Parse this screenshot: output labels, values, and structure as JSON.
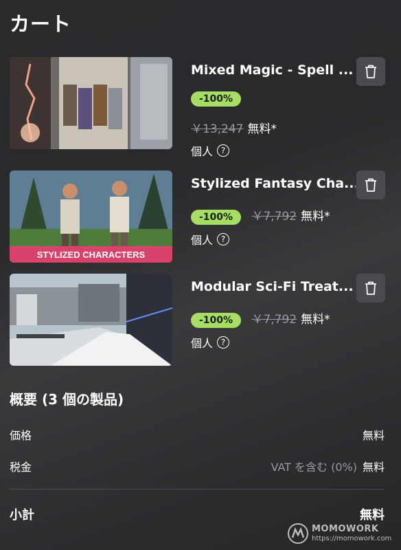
{
  "page": {
    "title": "カート"
  },
  "colors": {
    "badge_green": "#a6dd62",
    "delete_bg": "#4b4b4f",
    "muted": "#9a9a9e"
  },
  "cart": {
    "items": [
      {
        "name": "Mixed Magic - Spell ...",
        "discount": "-100%",
        "original_price": "￥13,247",
        "price": "無料*",
        "license": "個人",
        "help": "?",
        "delete_icon": "trash-icon"
      },
      {
        "name": "Stylized Fantasy Cha...",
        "discount": "-100%",
        "original_price": "￥7,792",
        "price": "無料*",
        "license": "個人",
        "help": "?",
        "thumb_banner": "STYLIZED CHARACTERS",
        "delete_icon": "trash-icon"
      },
      {
        "name": "Modular Sci-Fi Treat...",
        "discount": "-100%",
        "original_price": "￥7,792",
        "price": "無料*",
        "license": "個人",
        "help": "?",
        "delete_icon": "trash-icon"
      }
    ]
  },
  "summary": {
    "title": "概要 (3 個の製品)",
    "price_label": "価格",
    "price_value": "無料",
    "tax_label": "税金",
    "tax_note": "VAT を含む (0%)",
    "tax_value": "無料",
    "subtotal_label": "小計",
    "subtotal_value": "無料"
  },
  "watermark": {
    "name": "MOMOWORK",
    "url": "https://momowork.com"
  }
}
